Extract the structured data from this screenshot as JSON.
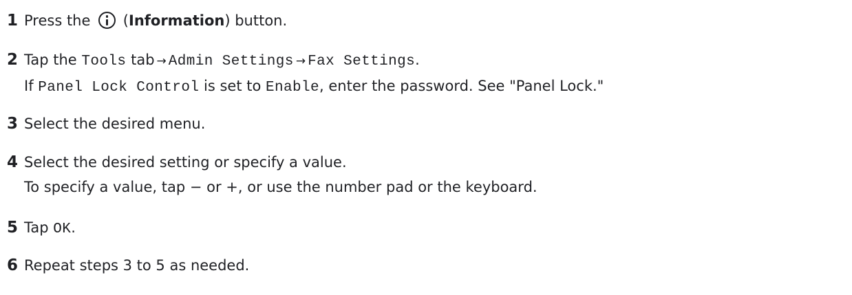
{
  "steps": [
    {
      "number": "1",
      "pre": "Press the",
      "icon": "info-circle-icon",
      "open_paren": "(",
      "bold": "Information",
      "post": ") button."
    },
    {
      "number": "2",
      "a": "Tap the",
      "tools": "Tools",
      "b": "tab",
      "arrow1": "→",
      "admin": "Admin Settings",
      "arrow2": "→",
      "fax": "Fax Settings",
      "period": ".",
      "sub_a": "If",
      "panel_lock_control": "Panel Lock Control",
      "sub_b": "is set to",
      "enable": "Enable",
      "sub_c": ", enter the password. See \"Panel Lock.\""
    },
    {
      "number": "3",
      "text": "Select the desired menu."
    },
    {
      "number": "4",
      "text": "Select the desired setting or specify a value.",
      "sub": "To specify a value, tap − or +, or use the number pad or the keyboard."
    },
    {
      "number": "5",
      "a": "Tap",
      "ok": "OK",
      "period": "."
    },
    {
      "number": "6",
      "text": "Repeat steps 3 to 5 as needed."
    }
  ]
}
